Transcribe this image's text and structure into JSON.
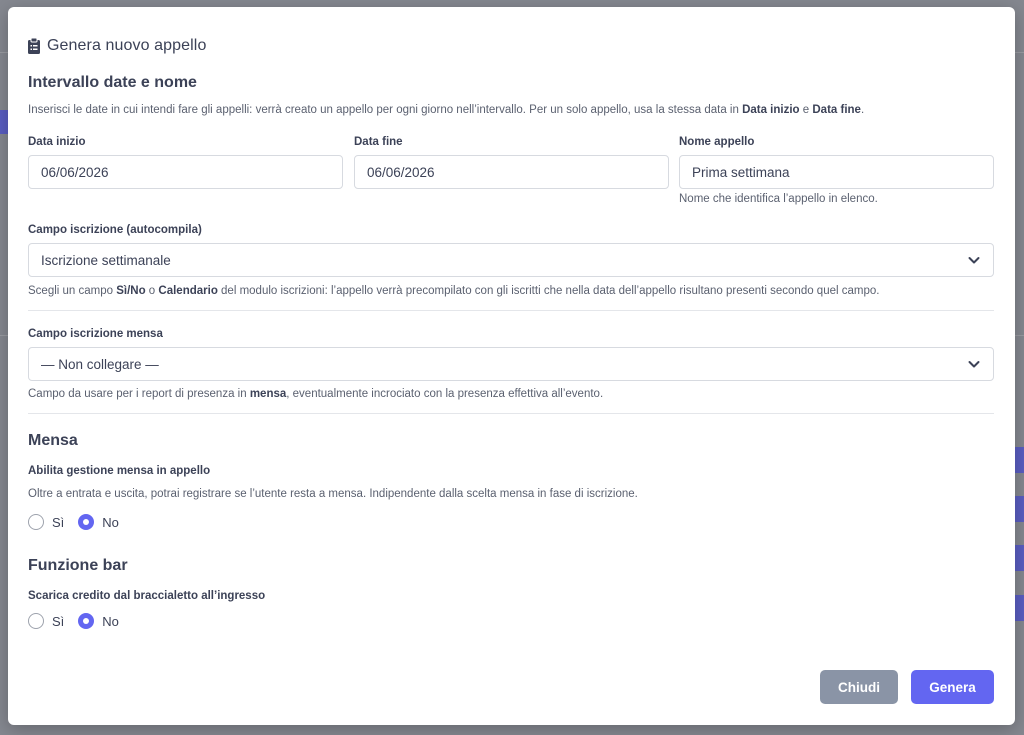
{
  "modal": {
    "title": "Genera nuovo appello"
  },
  "dates_section": {
    "title": "Intervallo date e nome",
    "help_prefix": "Inserisci le date in cui intendi fare gli appelli: verrà creato un appello per ogni giorno nell’intervallo. Per un solo appello, usa la stessa data in ",
    "help_bold1": "Data inizio",
    "help_mid": " e ",
    "help_bold2": "Data fine",
    "help_suffix": ".",
    "start_label": "Data inizio",
    "start_value": "06/06/2026",
    "end_label": "Data fine",
    "end_value": "06/06/2026",
    "name_label": "Nome appello",
    "name_value": "Prima settimana",
    "name_help": "Nome che identifica l’appello in elenco."
  },
  "enrollment_field": {
    "label": "Campo iscrizione (autocompila)",
    "selected": "Iscrizione settimanale",
    "help_prefix": "Scegli un campo ",
    "help_bold1": "Sì/No",
    "help_mid": " o ",
    "help_bold2": "Calendario",
    "help_suffix": " del modulo iscrizioni: l’appello verrà precompilato con gli iscritti che nella data dell’appello risultano presenti secondo quel campo."
  },
  "canteen_field": {
    "label": "Campo iscrizione mensa",
    "selected": "— Non collegare —",
    "help_prefix": "Campo da usare per i report di presenza in ",
    "help_bold": "mensa",
    "help_suffix": ", eventualmente incrociato con la presenza effettiva all’evento."
  },
  "canteen_section": {
    "title": "Mensa",
    "label": "Abilita gestione mensa in appello",
    "help": "Oltre a entrata e uscita, potrai registrare se l’utente resta a mensa. Indipendente dalla scelta mensa in fase di iscrizione.",
    "option_yes": "Sì",
    "option_no": "No",
    "selected": "No"
  },
  "bar_section": {
    "title": "Funzione bar",
    "label": "Scarica credito dal braccialetto all’ingresso",
    "option_yes": "Sì",
    "option_no": "No",
    "selected": "No"
  },
  "footer": {
    "close_label": "Chiudi",
    "generate_label": "Genera"
  },
  "colors": {
    "accent": "#6366f1",
    "close_button": "#8a94a6",
    "overlay": "#7d8085"
  },
  "icons": {
    "title_icon": "clipboard-icon",
    "select_icon": "chevron-down-icon"
  }
}
